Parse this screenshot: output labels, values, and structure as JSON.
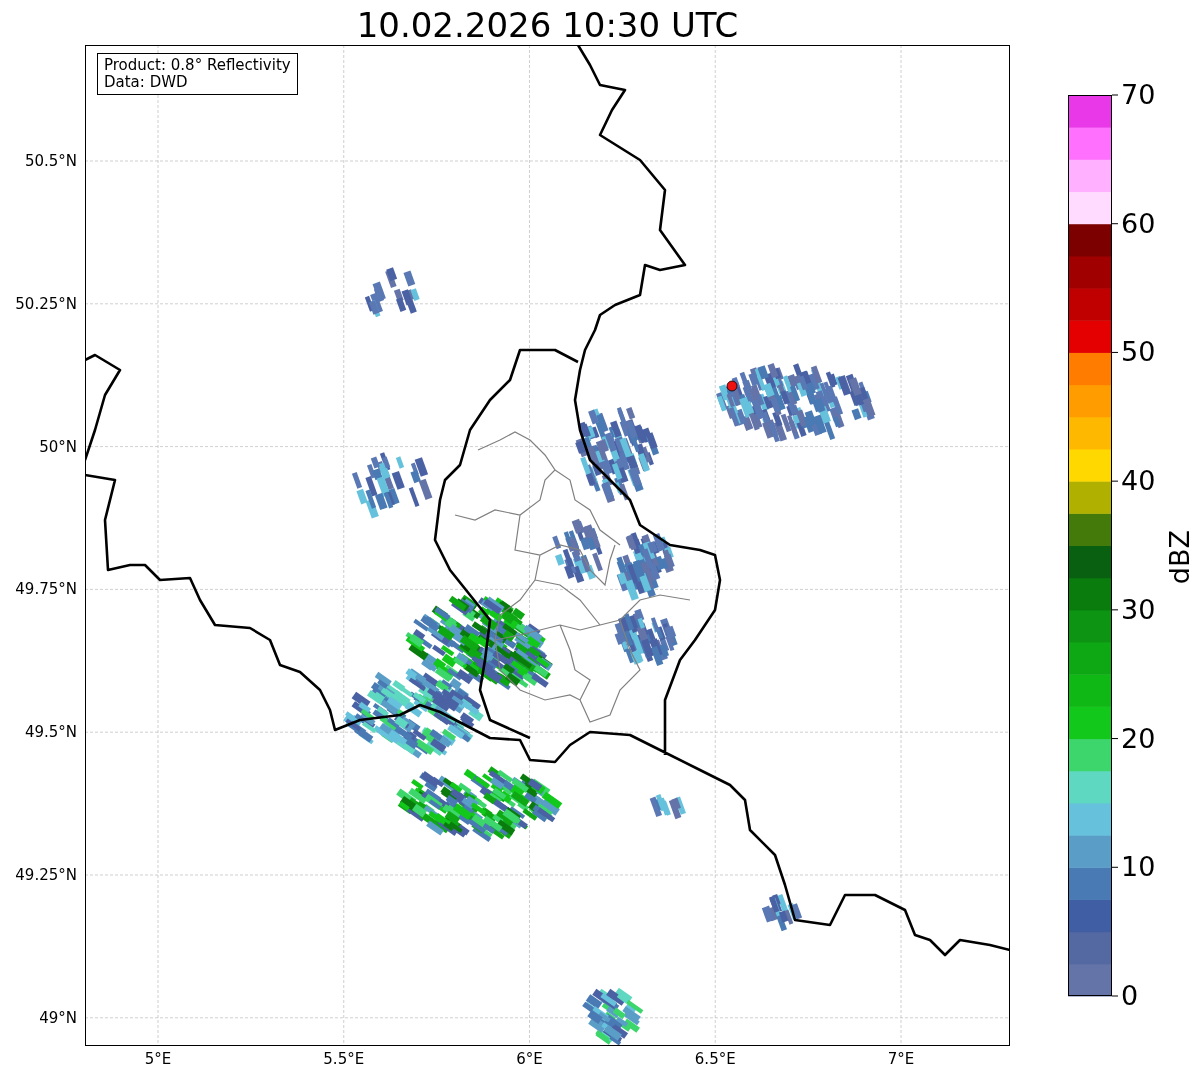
{
  "title": "10.02.2026 10:30 UTC",
  "info_box": [
    "Product: 0.8° Reflectivity",
    "Data: DWD"
  ],
  "map": {
    "y_ticks": [
      "50.5°N",
      "50.25°N",
      "50°N",
      "49.75°N",
      "49.5°N",
      "49.25°N",
      "49°N"
    ],
    "x_ticks": [
      "5°E",
      "5.5°E",
      "6°E",
      "6.5°E",
      "7°E"
    ]
  },
  "colorbar": {
    "label": "dBZ",
    "ticks": [
      "70",
      "60",
      "50",
      "40",
      "30",
      "20",
      "10",
      "0"
    ]
  }
}
